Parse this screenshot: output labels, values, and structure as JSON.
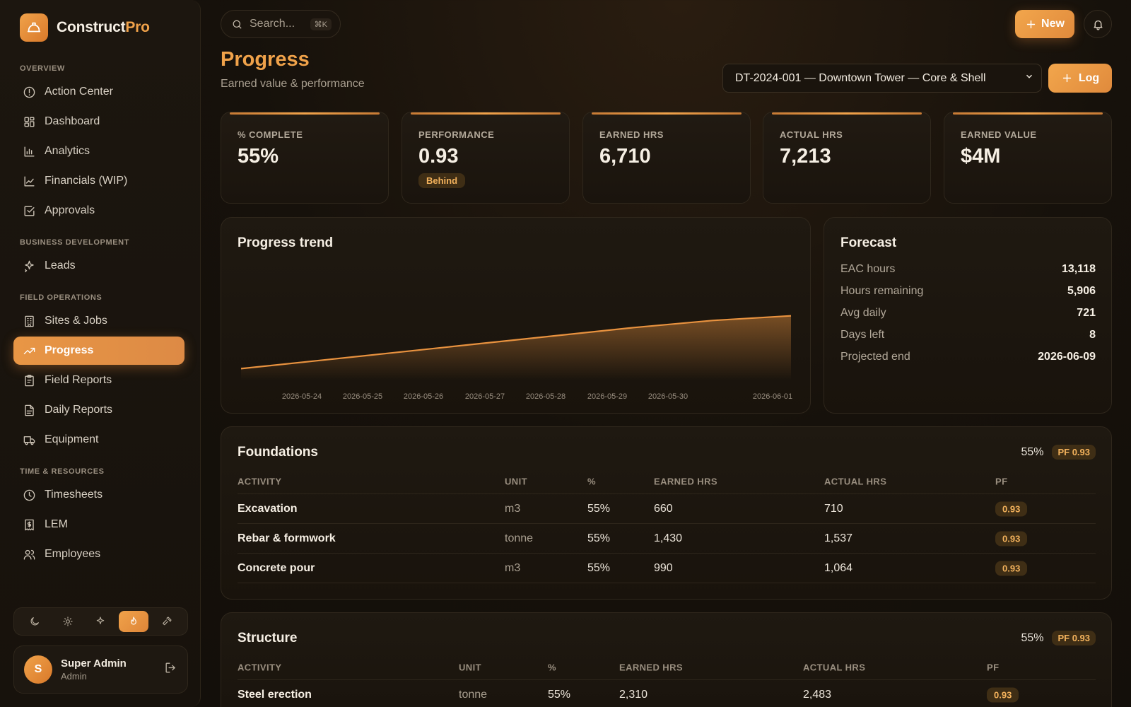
{
  "brand": {
    "name_main": "Construct",
    "name_accent": "Pro",
    "logo_icon": "hardhat-icon"
  },
  "sidebar": {
    "sections": [
      {
        "title": "OVERVIEW",
        "items": [
          {
            "label": "Action Center",
            "icon": "alert-circle-icon"
          },
          {
            "label": "Dashboard",
            "icon": "grid-icon"
          },
          {
            "label": "Analytics",
            "icon": "bar-chart-icon"
          },
          {
            "label": "Financials (WIP)",
            "icon": "line-chart-icon"
          },
          {
            "label": "Approvals",
            "icon": "check-square-icon"
          }
        ]
      },
      {
        "title": "BUSINESS DEVELOPMENT",
        "items": [
          {
            "label": "Leads",
            "icon": "sparkle-icon"
          }
        ]
      },
      {
        "title": "FIELD OPERATIONS",
        "items": [
          {
            "label": "Sites & Jobs",
            "icon": "building-icon"
          },
          {
            "label": "Progress",
            "icon": "trending-up-icon",
            "active": true
          },
          {
            "label": "Field Reports",
            "icon": "clipboard-icon"
          },
          {
            "label": "Daily Reports",
            "icon": "file-text-icon"
          },
          {
            "label": "Equipment",
            "icon": "truck-icon"
          }
        ]
      },
      {
        "title": "TIME & RESOURCES",
        "items": [
          {
            "label": "Timesheets",
            "icon": "clock-icon"
          },
          {
            "label": "LEM",
            "icon": "receipt-icon"
          },
          {
            "label": "Employees",
            "icon": "users-icon"
          }
        ]
      }
    ],
    "themes": [
      "moon-icon",
      "sun-icon",
      "sparkle-icon",
      "flame-icon",
      "hammer-icon"
    ],
    "active_theme": "flame-icon",
    "user": {
      "initial": "S",
      "name": "Super Admin",
      "role": "Admin"
    }
  },
  "topbar": {
    "search_placeholder": "Search...",
    "shortcut": "⌘K",
    "new_label": "New"
  },
  "header": {
    "title": "Progress",
    "subtitle": "Earned value & performance",
    "project": "DT-2024-001 — Downtown Tower — Core & Shell",
    "log_label": "Log"
  },
  "kpis": [
    {
      "label": "% COMPLETE",
      "value": "55%"
    },
    {
      "label": "PERFORMANCE",
      "value": "0.93",
      "badge": "Behind"
    },
    {
      "label": "EARNED HRS",
      "value": "6,710"
    },
    {
      "label": "ACTUAL HRS",
      "value": "7,213"
    },
    {
      "label": "EARNED VALUE",
      "value": "$4M"
    }
  ],
  "trend": {
    "title": "Progress trend",
    "chart_data": {
      "type": "area",
      "x": [
        "2026-05-24",
        "2026-05-25",
        "2026-05-26",
        "2026-05-27",
        "2026-05-28",
        "2026-05-29",
        "2026-05-30",
        "2026-06-01"
      ],
      "x_tick_labels": [
        "2026-05-24",
        "2026-05-25",
        "2026-05-26",
        "2026-05-27",
        "2026-05-28",
        "2026-05-29",
        "2026-05-30",
        "2026-06-01"
      ],
      "series": [
        {
          "values": [
            10,
            17,
            24,
            31,
            38,
            45,
            51,
            55
          ]
        }
      ],
      "ylim": [
        0,
        100
      ],
      "grid": false,
      "color": "#e8923f"
    }
  },
  "forecast": {
    "title": "Forecast",
    "rows": [
      {
        "label": "EAC hours",
        "value": "13,118"
      },
      {
        "label": "Hours remaining",
        "value": "5,906"
      },
      {
        "label": "Avg daily",
        "value": "721"
      },
      {
        "label": "Days left",
        "value": "8"
      },
      {
        "label": "Projected end",
        "value": "2026-06-09"
      }
    ]
  },
  "table_headers": {
    "activity": "ACTIVITY",
    "unit": "UNIT",
    "pct": "%",
    "earned": "EARNED HRS",
    "actual": "ACTUAL HRS",
    "pf": "PF"
  },
  "sections": [
    {
      "title": "Foundations",
      "pct": "55%",
      "pf": "PF 0.93",
      "rows": [
        {
          "activity": "Excavation",
          "unit": "m3",
          "pct": "55%",
          "earned": "660",
          "actual": "710",
          "pf": "0.93"
        },
        {
          "activity": "Rebar & formwork",
          "unit": "tonne",
          "pct": "55%",
          "earned": "1,430",
          "actual": "1,537",
          "pf": "0.93"
        },
        {
          "activity": "Concrete pour",
          "unit": "m3",
          "pct": "55%",
          "earned": "990",
          "actual": "1,064",
          "pf": "0.93"
        }
      ]
    },
    {
      "title": "Structure",
      "pct": "55%",
      "pf": "PF 0.93",
      "rows": [
        {
          "activity": "Steel erection",
          "unit": "tonne",
          "pct": "55%",
          "earned": "2,310",
          "actual": "2,483",
          "pf": "0.93"
        }
      ]
    }
  ],
  "colors": {
    "accent": "#f0a24a",
    "background": "#16110b",
    "badge_bg": "#3f2e15",
    "badge_text": "#f3b25c"
  }
}
